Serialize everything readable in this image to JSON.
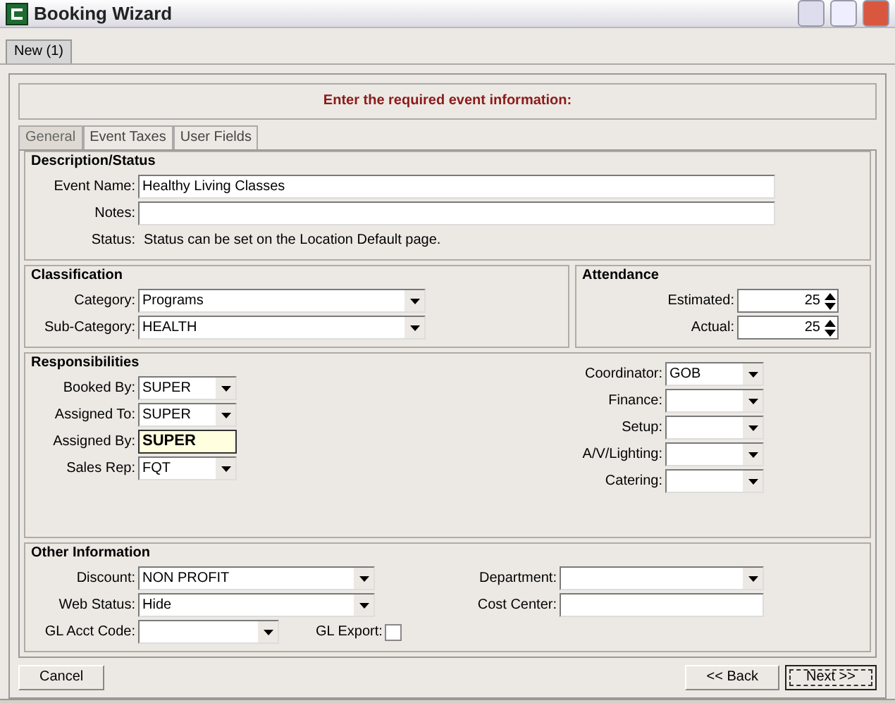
{
  "window": {
    "title": "Booking Wizard"
  },
  "document_tabs": [
    {
      "label": "New (1)",
      "selected": true
    }
  ],
  "banner": "Enter the required event information:",
  "tabs": [
    {
      "label": "General",
      "selected": true
    },
    {
      "label": "Event Taxes",
      "selected": false
    },
    {
      "label": "User Fields",
      "selected": false
    }
  ],
  "description_status": {
    "title": "Description/Status",
    "event_name": {
      "label": "Event Name:",
      "value": "Healthy Living Classes"
    },
    "notes": {
      "label": "Notes:"
    },
    "status": {
      "label": "Status:",
      "text": "Status can be set on the Location Default page."
    }
  },
  "classification": {
    "title": "Classification",
    "fields": [
      {
        "label": "Category:",
        "value": "Programs"
      },
      {
        "label": "Sub-Category:",
        "value": "HEALTH"
      }
    ]
  },
  "attendance": {
    "title": "Attendance",
    "fields": [
      {
        "label": "Estimated:",
        "value": "25"
      },
      {
        "label": "Actual:",
        "value": "25"
      }
    ]
  },
  "responsibilities": {
    "title": "Responsibilities",
    "left": [
      {
        "kind": "dropdown",
        "label": "Booked By:",
        "value": "SUPER",
        "focused": false
      },
      {
        "kind": "dropdown",
        "label": "Assigned To:",
        "value": "SUPER",
        "focused": false
      },
      {
        "kind": "edit",
        "label": "Assigned By:",
        "value": "SUPER",
        "focused": true
      },
      {
        "kind": "dropdown",
        "label": "Sales Rep:",
        "value": "FQT",
        "focused": false
      }
    ],
    "right": [
      {
        "kind": "dropdown",
        "label": "Coordinator:",
        "value": "GOB",
        "focused": false
      },
      {
        "kind": "dropdown",
        "label": "Finance:",
        "focused": false
      },
      {
        "kind": "dropdown",
        "label": "Setup:",
        "focused": false
      },
      {
        "kind": "dropdown",
        "label": "A/V/Lighting:",
        "focused": false
      },
      {
        "kind": "dropdown",
        "label": "Catering:",
        "focused": false
      }
    ]
  },
  "other_information": {
    "title": "Other Information",
    "left": [
      {
        "kind": "dropdown",
        "label": "Discount:",
        "value": "NON PROFIT",
        "focused": false
      },
      {
        "kind": "dropdown",
        "label": "Web Status:",
        "value": "Hide",
        "focused": false
      }
    ],
    "gl_acct_code": {
      "label": "GL Acct Code:"
    },
    "gl_export": {
      "label": "GL Export:",
      "checked": false
    },
    "right": [
      {
        "kind": "dropdown",
        "label": "Department:",
        "focused": false
      },
      {
        "kind": "edit",
        "label": "Cost Center:",
        "focused": false
      }
    ]
  },
  "buttons": {
    "cancel": "Cancel",
    "back": "<< Back",
    "next": "Next >>"
  }
}
